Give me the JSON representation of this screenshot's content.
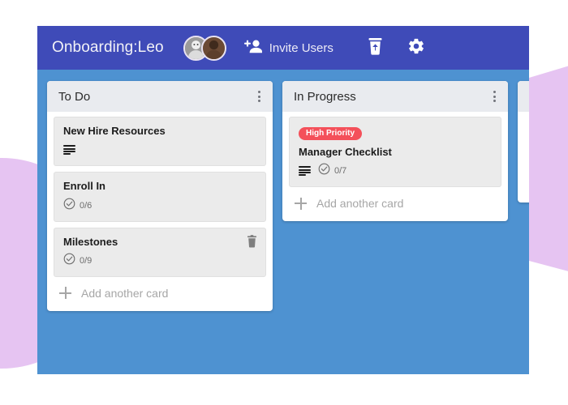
{
  "colors": {
    "topbar": "#3f4bb8",
    "board": "#4e92d1",
    "list_header": "#e9ebef",
    "card": "#ebebeb",
    "badge_high_priority": "#f4505a",
    "decor_lavender": "#e6c4f2"
  },
  "topbar": {
    "board_title": "Onboarding:Leo",
    "invite_label": "Invite Users",
    "invite_icon": "add-person-icon",
    "archive_icon": "trash-restore-icon",
    "settings_icon": "gear-icon",
    "avatars": [
      {
        "name": "avatar-member-1"
      },
      {
        "name": "avatar-member-2"
      }
    ]
  },
  "board": {
    "lists": [
      {
        "title": "To Do",
        "menu_icon": "more-vertical-icon",
        "add_card_label": "Add another card",
        "cards": [
          {
            "title": "New Hire Resources",
            "badge": null,
            "has_description": true,
            "checklist": null,
            "deletable": false
          },
          {
            "title": "Enroll In",
            "badge": null,
            "has_description": false,
            "checklist": "0/6",
            "deletable": false
          },
          {
            "title": "Milestones",
            "badge": null,
            "has_description": false,
            "checklist": "0/9",
            "deletable": true
          }
        ]
      },
      {
        "title": "In Progress",
        "menu_icon": "more-vertical-icon",
        "add_card_label": "Add another card",
        "cards": [
          {
            "title": "Manager Checklist",
            "badge": "High Priority",
            "has_description": true,
            "checklist": "0/7",
            "deletable": false
          }
        ]
      },
      {
        "title": "",
        "menu_icon": "more-vertical-icon",
        "add_card_label": "",
        "cards": []
      }
    ]
  }
}
